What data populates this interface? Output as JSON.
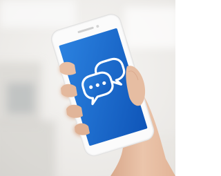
{
  "scene": {
    "subject": "hand-holding-smartphone",
    "screen_icon": "chat-bubbles-icon",
    "colors": {
      "background_light": "#f2f1ef",
      "background_mid": "#e3e1dd",
      "phone_body": "#f7f7f7",
      "screen_blue": "#1d6fd0",
      "screen_blue_dark": "#0f55b8",
      "skin": "#e9c3a8",
      "skin_shadow": "#d6a88c",
      "icon_white": "#ffffff"
    }
  }
}
